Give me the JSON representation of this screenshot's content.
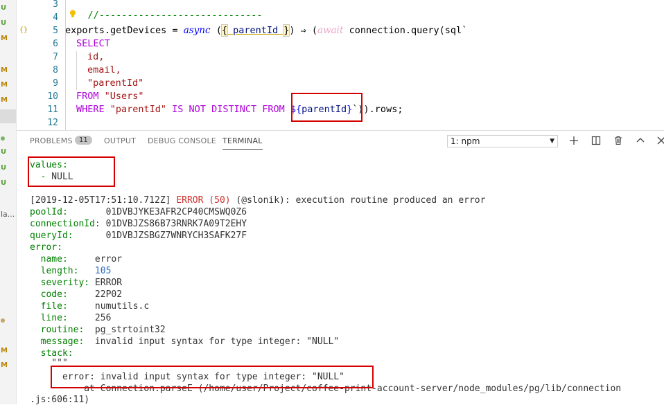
{
  "left_strip": {
    "items": [
      {
        "label": "U",
        "color": "#5aa03a"
      },
      {
        "label": "U",
        "color": "#5aa03a"
      },
      {
        "label": "M",
        "color": "#b8860b"
      },
      {
        "label": "M",
        "color": "#b8860b"
      },
      {
        "label": "M",
        "color": "#b8860b"
      },
      {
        "label": "M",
        "color": "#b8860b"
      },
      {
        "label": "U",
        "color": "#5aa03a"
      },
      {
        "label": "U",
        "color": "#5aa03a"
      },
      {
        "label": "U",
        "color": "#5aa03a"
      },
      {
        "label": "la...",
        "color": "#555555"
      },
      {
        "label": "M",
        "color": "#b8860b"
      },
      {
        "label": "M",
        "color": "#b8860b"
      }
    ]
  },
  "editor": {
    "line_numbers": [
      "3",
      "4",
      "5",
      "6",
      "7",
      "8",
      "9",
      "10",
      "11",
      "12"
    ],
    "fold_marker": "{}",
    "line3": "//-----------------------------",
    "line5": {
      "obj": "exports.getDevices",
      "eq": " = ",
      "async": "async",
      "open": " (",
      "brace_open": "{",
      "param": " parentId ",
      "brace_close": "}",
      "arrow": ") ⇒ (",
      "await": "await",
      "call": " connection.query(sql`"
    },
    "line6": "SELECT",
    "line7": "id,",
    "line8": "email,",
    "line9": "\"parentId\"",
    "line10_kw": "FROM",
    "line10_str": " \"Users\"",
    "line11": {
      "kw1": "WHERE",
      "str": " \"parentId\"",
      "kw2": " IS NOT DISTINCT FROM",
      "tmpl_open": " ${",
      "param": "parentId",
      "tmpl_close": "}",
      "rest": "`)).rows;"
    }
  },
  "panel": {
    "tabs": {
      "problems": "PROBLEMS",
      "problems_count": "11",
      "output": "OUTPUT",
      "debug_console": "DEBUG CONSOLE",
      "terminal": "TERMINAL"
    },
    "terminal_select": "1: npm"
  },
  "terminal": {
    "values_label": "values:",
    "values_item": "  - NULL",
    "log_ts": "[2019-12-05T17:51:10.712Z] ",
    "log_level": "ERROR (50)",
    "log_msg": " (@slonik): execution routine produced an error",
    "poolId_key": "poolId:",
    "poolId_val": "       01DVBJYKE3AFR2CP40CMSWQ0Z6",
    "connectionId_key": "connectionId:",
    "connectionId_val": " 01DVBJZS86B73RNRK7A09T2EHY",
    "queryId_key": "queryId:",
    "queryId_val": "      01DVBJZSBGZ7WNRYCH3SAFK27F",
    "error_key": "error:",
    "fields": [
      {
        "key": "  name:     ",
        "val": "error",
        "cls": "t-dark"
      },
      {
        "key": "  length:   ",
        "val": "105",
        "cls": "t-blue"
      },
      {
        "key": "  severity: ",
        "val": "ERROR",
        "cls": "t-dark"
      },
      {
        "key": "  code:     ",
        "val": "22P02",
        "cls": "t-dark"
      },
      {
        "key": "  file:     ",
        "val": "numutils.c",
        "cls": "t-dark"
      },
      {
        "key": "  line:     ",
        "val": "256",
        "cls": "t-dark"
      },
      {
        "key": "  routine:  ",
        "val": "pg_strtoint32",
        "cls": "t-dark"
      },
      {
        "key": "  message:  ",
        "val": "invalid input syntax for type integer: \"NULL\"",
        "cls": "t-dark"
      }
    ],
    "stack_key": "  stack:",
    "stack_quote": "    \"\"\"",
    "stack_error": "      error: invalid input syntax for type integer: \"NULL\"",
    "stack_at": "          at Connection.parseE (/home/user/Project/coffee-print-account-server/node_modules/pg/lib/connection",
    "stack_end": ".js:606:11)"
  }
}
